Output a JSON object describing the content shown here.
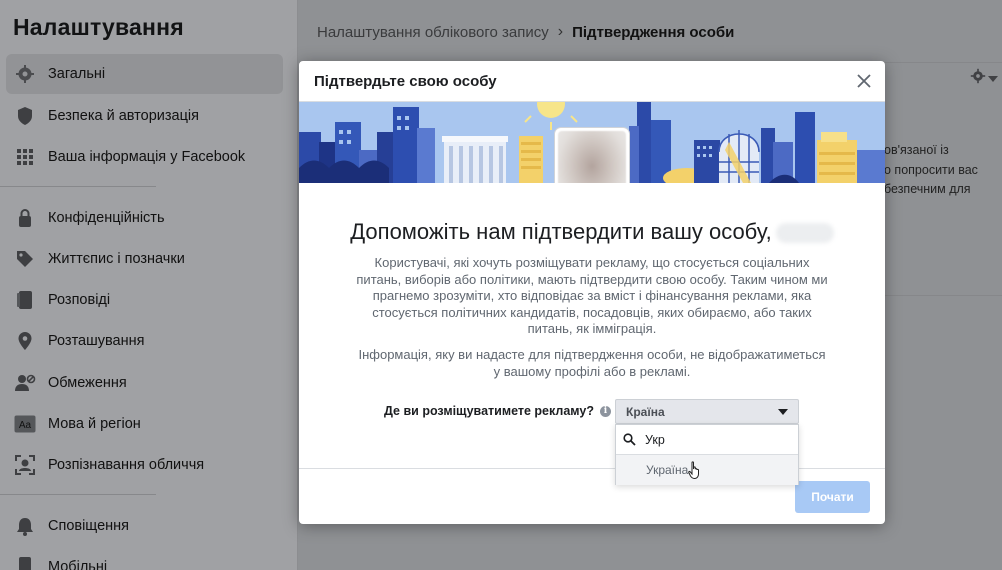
{
  "sidebar": {
    "title": "Налаштування",
    "items": [
      {
        "label": "Загальні",
        "icon": "gear-icon"
      },
      {
        "label": "Безпека й авторизація",
        "icon": "shield-icon"
      },
      {
        "label": "Ваша інформація у Facebook",
        "icon": "grid-icon"
      },
      {
        "label": "Конфіденційність",
        "icon": "lock-icon"
      },
      {
        "label": "Життєпис і позначки",
        "icon": "tag-icon"
      },
      {
        "label": "Розповіді",
        "icon": "book-icon"
      },
      {
        "label": "Розташування",
        "icon": "location-pin-icon"
      },
      {
        "label": "Обмеження",
        "icon": "person-block-icon"
      },
      {
        "label": "Мова й регіон",
        "icon": "language-icon"
      },
      {
        "label": "Розпізнавання обличчя",
        "icon": "face-recognition-icon"
      },
      {
        "label": "Сповіщення",
        "icon": "bell-icon"
      },
      {
        "label": "Мобільні",
        "icon": "phone-icon"
      }
    ]
  },
  "breadcrumb": {
    "parent": "Налаштування облікового запису",
    "separator": "›",
    "current": "Підтвердження особи"
  },
  "background_text": {
    "line1": "ов'язаної із",
    "line2": "о попросити вас",
    "line3": "безпечним для"
  },
  "modal": {
    "title": "Підтвердьте свою особу",
    "headline": "Допоможіть нам підтвердити вашу особу,",
    "paragraph1": "Користувачі, які хочуть розміщувати рекламу, що стосується соціальних питань, виборів або політики, мають підтвердити свою особу. Таким чином ми прагнемо зрозуміти, хто відповідає за вміст і фінансування реклами, яка стосується політичних кандидатів, посадовців, яких обираємо, або таких питань, як імміграція.",
    "paragraph2": "Інформація, яку ви надасте для підтвердження особи, не відображатиметься у вашому профілі або в рекламі.",
    "question": "Де ви розміщуватимете рекламу?",
    "info_icon_glyph": "i",
    "select_value": "Країна",
    "search_value": "Укр",
    "option": "Україна",
    "start_button": "Почати"
  },
  "colors": {
    "banner_bg": "#a9c6ef",
    "primary_disabled": "#a8c9f5",
    "overlay": "#8f9194"
  }
}
